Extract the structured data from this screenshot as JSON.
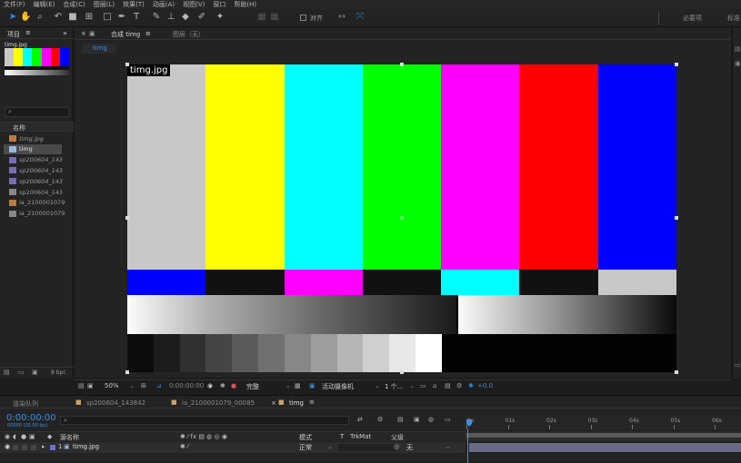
{
  "menu": [
    "文件(F)",
    "编辑(E)",
    "合成(C)",
    "图层(L)",
    "效果(T)",
    "动画(A)",
    "视图(V)",
    "窗口",
    "帮助(H)"
  ],
  "toolbar": {
    "align_label": "对齐",
    "workspace_label": "必要项",
    "workspace2_label": "标准"
  },
  "project": {
    "tab_label": "项目",
    "preview_name": "timg.jpg",
    "search_placeholder": "",
    "column_name": "名称",
    "items": [
      {
        "name": "timg.jpg",
        "type": "image"
      },
      {
        "name": "timg",
        "type": "comp"
      },
      {
        "name": "sp200604_143",
        "type": "video"
      },
      {
        "name": "sp200604_143",
        "type": "video"
      },
      {
        "name": "sp200604_143",
        "type": "video"
      },
      {
        "name": "sp200604_143",
        "type": "solid"
      },
      {
        "name": "ia_2100001079",
        "type": "image"
      },
      {
        "name": "ia_2100001079",
        "type": "solid"
      }
    ],
    "bpc_label": "8 bpc"
  },
  "comp": {
    "tab_label": "合成 timg",
    "tab_menu": "≡",
    "layer_tab_label": "图层（无）",
    "breadcrumb": "timg",
    "layer_name_overlay": "timg.jpg",
    "zoom": "50%",
    "timecode": "0:00:00:00",
    "resolution": "完整",
    "camera": "活动摄像机",
    "views": "1 个...",
    "exposure": "+0.0"
  },
  "colors": {
    "accent": "#2d8ceb",
    "timecode": "#3c8fe6",
    "playhead": "#3c8fe6"
  },
  "colorbars": {
    "top": [
      "#c8c8c8",
      "#ffff00",
      "#00ffff",
      "#00ff00",
      "#ff00ff",
      "#ff0000",
      "#0000ff"
    ],
    "mid": [
      "#0000ff",
      "#111111",
      "#ff00ff",
      "#111111",
      "#00ffff",
      "#111111",
      "#c8c8c8"
    ],
    "steps": [
      "#0c0c0c",
      "#1c1c1c",
      "#303030",
      "#454545",
      "#5a5a5a",
      "#707070",
      "#878787",
      "#9e9e9e",
      "#b6b6b6",
      "#cfcfcf",
      "#e8e8e8",
      "#ffffff"
    ]
  },
  "timeline": {
    "tabs": [
      "渲染队列",
      "sp200604_143842",
      "ia_2100001079_00085",
      "timg"
    ],
    "timecode": "0:00:00:00",
    "fps_label": "00000 (25.00 fps)",
    "search_placeholder": "",
    "col_source": "源名称",
    "col_mode": "模式",
    "col_t": "T",
    "col_trkmat": "TrkMat",
    "col_parent": "父级",
    "ruler": [
      "0s",
      "01s",
      "02s",
      "03s",
      "04s",
      "05s",
      "06s"
    ],
    "layer": {
      "index": "1",
      "name": "timg.jpg",
      "mode": "正常",
      "parent": "无"
    }
  }
}
